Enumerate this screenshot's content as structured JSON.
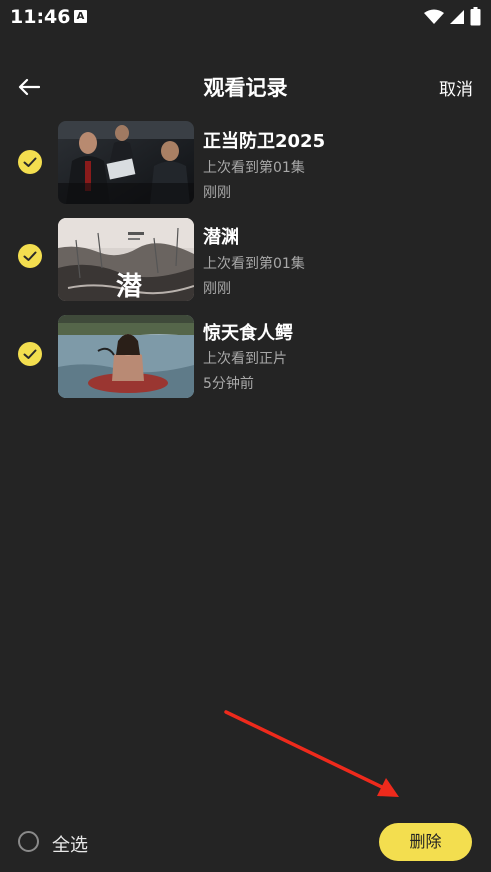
{
  "status": {
    "time": "11:46",
    "a_badge": "A"
  },
  "header": {
    "title": "观看记录",
    "cancel": "取消"
  },
  "items": [
    {
      "title": "正当防卫2025",
      "progress": "上次看到第01集",
      "time": "刚刚"
    },
    {
      "title": "潜渊",
      "progress": "上次看到第01集",
      "time": "刚刚",
      "poster_text": "潜"
    },
    {
      "title": "惊天食人鳄",
      "progress": "上次看到正片",
      "time": "5分钟前"
    }
  ],
  "bottom": {
    "select_all": "全选",
    "delete": "删除"
  },
  "colors": {
    "background": "#242424",
    "accent": "#f3de4f",
    "muted_text": "#a8a8a8",
    "arrow": "#ee2a1c"
  }
}
